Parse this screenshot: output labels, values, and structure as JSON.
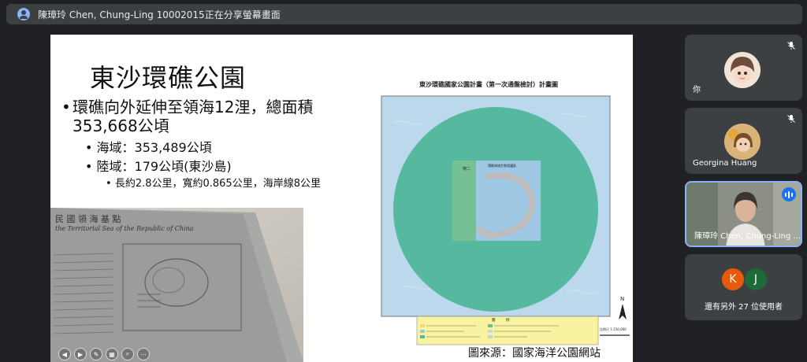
{
  "share_bar": {
    "text": "陳璋玲 Chen, Chung-Ling 10002015正在分享螢幕畫面",
    "icon": "presenter-icon"
  },
  "slide": {
    "title": "東沙環礁公園",
    "bullet1": "環礁向外延伸至領海12浬，總面積",
    "bullet1_cont": "353,668公頃",
    "sub1": "海域：353,489公頃",
    "sub2": "陸域：179公頃(東沙島)",
    "sub3": "長約2.8公里，寬約0.865公里，海岸線8公里",
    "map_title": "東沙環礁國家公園計畫（第一次通盤檢討）計畫圖",
    "caption": "圖來源：國家海洋公園網站",
    "photo_header": "民 國 領 海 基 點",
    "photo_sub": "the Territorial Sea of the Republic of China",
    "map_legend_title": "圖　　　例",
    "map_label_1": "特二",
    "map_label_2": "環礁海域生態保護區",
    "map_north": "N",
    "map_scale": "比例尺 1:150,000"
  },
  "participants": [
    {
      "name": "你",
      "mic": "muted"
    },
    {
      "name": "Georgina Huang",
      "mic": "muted"
    },
    {
      "name": "陳璋玲 Chen, Chung-Ling ...",
      "mic": "speaking"
    }
  ],
  "more": {
    "initials": [
      "K",
      "J"
    ],
    "label": "還有另外 27 位使用者",
    "colors": [
      "#e8590c",
      "#1e6b3a"
    ]
  }
}
